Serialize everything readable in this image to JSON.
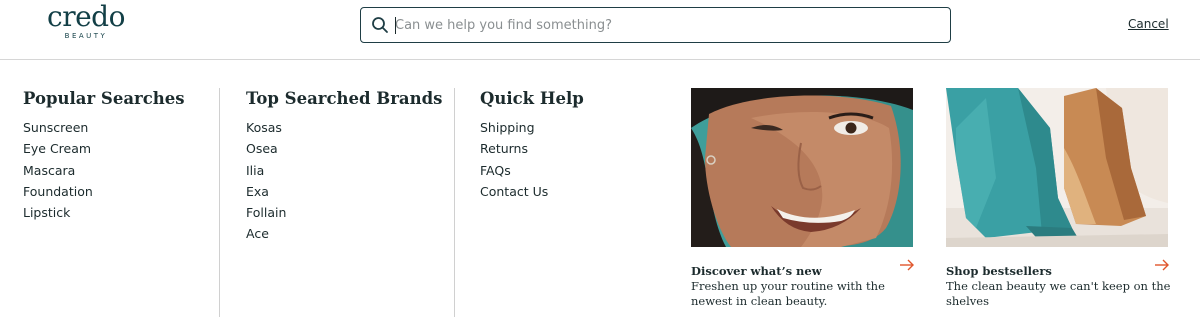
{
  "header": {
    "logo_word": "credo",
    "logo_sub": "BEAUTY",
    "search": {
      "placeholder": "Can we help you find something?",
      "value": ""
    },
    "cancel_label": "Cancel"
  },
  "popular_searches": {
    "title": "Popular Searches",
    "items": [
      "Sunscreen",
      "Eye Cream",
      "Mascara",
      "Foundation",
      "Lipstick"
    ]
  },
  "top_brands": {
    "title": "Top Searched Brands",
    "items": [
      "Kosas",
      "Osea",
      "Ilia",
      "Exa",
      "Follain",
      "Ace"
    ]
  },
  "quick_help": {
    "title": "Quick Help",
    "items": [
      "Shipping",
      "Returns",
      "FAQs",
      "Contact Us"
    ]
  },
  "promos": [
    {
      "title": "Discover what’s new",
      "description": "Freshen up your routine with the newest in clean beauty."
    },
    {
      "title": "Shop bestsellers",
      "description": "The clean beauty we can't keep on the shelves"
    }
  ],
  "colors": {
    "brand": "#123f46",
    "text": "#1c2b2d",
    "accent_arrow": "#e0552b",
    "photo_teal": "#3f9e9a"
  }
}
